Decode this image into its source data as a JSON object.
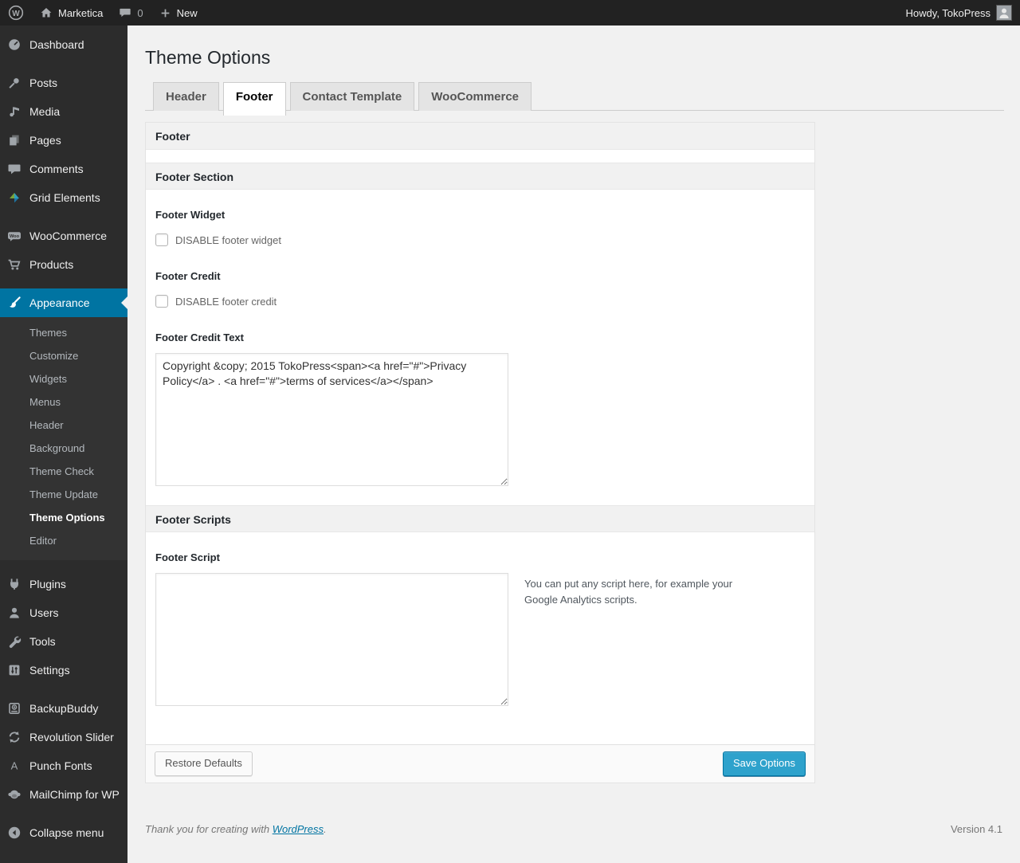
{
  "admin_bar": {
    "site_name": "Marketica",
    "comments_count": "0",
    "new_label": "New",
    "howdy_text": "Howdy, TokoPress"
  },
  "sidebar": {
    "items": {
      "dashboard": "Dashboard",
      "posts": "Posts",
      "media": "Media",
      "pages": "Pages",
      "comments": "Comments",
      "grid_elements": "Grid Elements",
      "woocommerce": "WooCommerce",
      "products": "Products",
      "appearance": "Appearance",
      "plugins": "Plugins",
      "users": "Users",
      "tools": "Tools",
      "settings": "Settings",
      "backupbuddy": "BackupBuddy",
      "revolution_slider": "Revolution Slider",
      "punch_fonts": "Punch Fonts",
      "mailchimp": "MailChimp for WP",
      "collapse": "Collapse menu"
    },
    "appearance_submenu": [
      "Themes",
      "Customize",
      "Widgets",
      "Menus",
      "Header",
      "Background",
      "Theme Check",
      "Theme Update",
      "Theme Options",
      "Editor"
    ],
    "current_submenu_item": "Theme Options"
  },
  "page": {
    "title": "Theme Options",
    "tabs": [
      "Header",
      "Footer",
      "Contact Template",
      "WooCommerce"
    ],
    "active_tab": "Footer"
  },
  "panel": {
    "header": "Footer",
    "section_title": "Footer Section",
    "footer_widget": {
      "label": "Footer Widget",
      "checkbox_label": "DISABLE footer widget"
    },
    "footer_credit": {
      "label": "Footer Credit",
      "checkbox_label": "DISABLE footer credit"
    },
    "footer_credit_text": {
      "label": "Footer Credit Text",
      "value": "Copyright &copy; 2015 TokoPress<span><a href=\"#\">Privacy Policy</a> . <a href=\"#\">terms of services</a></span>"
    },
    "scripts_section_title": "Footer Scripts",
    "footer_script": {
      "label": "Footer Script",
      "value": "",
      "help": "You can put any script here, for example your Google Analytics scripts."
    },
    "restore_button": "Restore Defaults",
    "save_button": "Save Options"
  },
  "page_footer": {
    "thanks_prefix": "Thank you for creating with ",
    "wordpress_link": "WordPress",
    "thanks_suffix": ".",
    "version": "Version 4.1"
  },
  "colors": {
    "accent_blue": "#0074a2",
    "primary_button": "#2ea2cc",
    "admin_bar_bg": "#222222",
    "sidebar_bg": "#2c2c2c",
    "page_bg": "#f1f1f1"
  }
}
